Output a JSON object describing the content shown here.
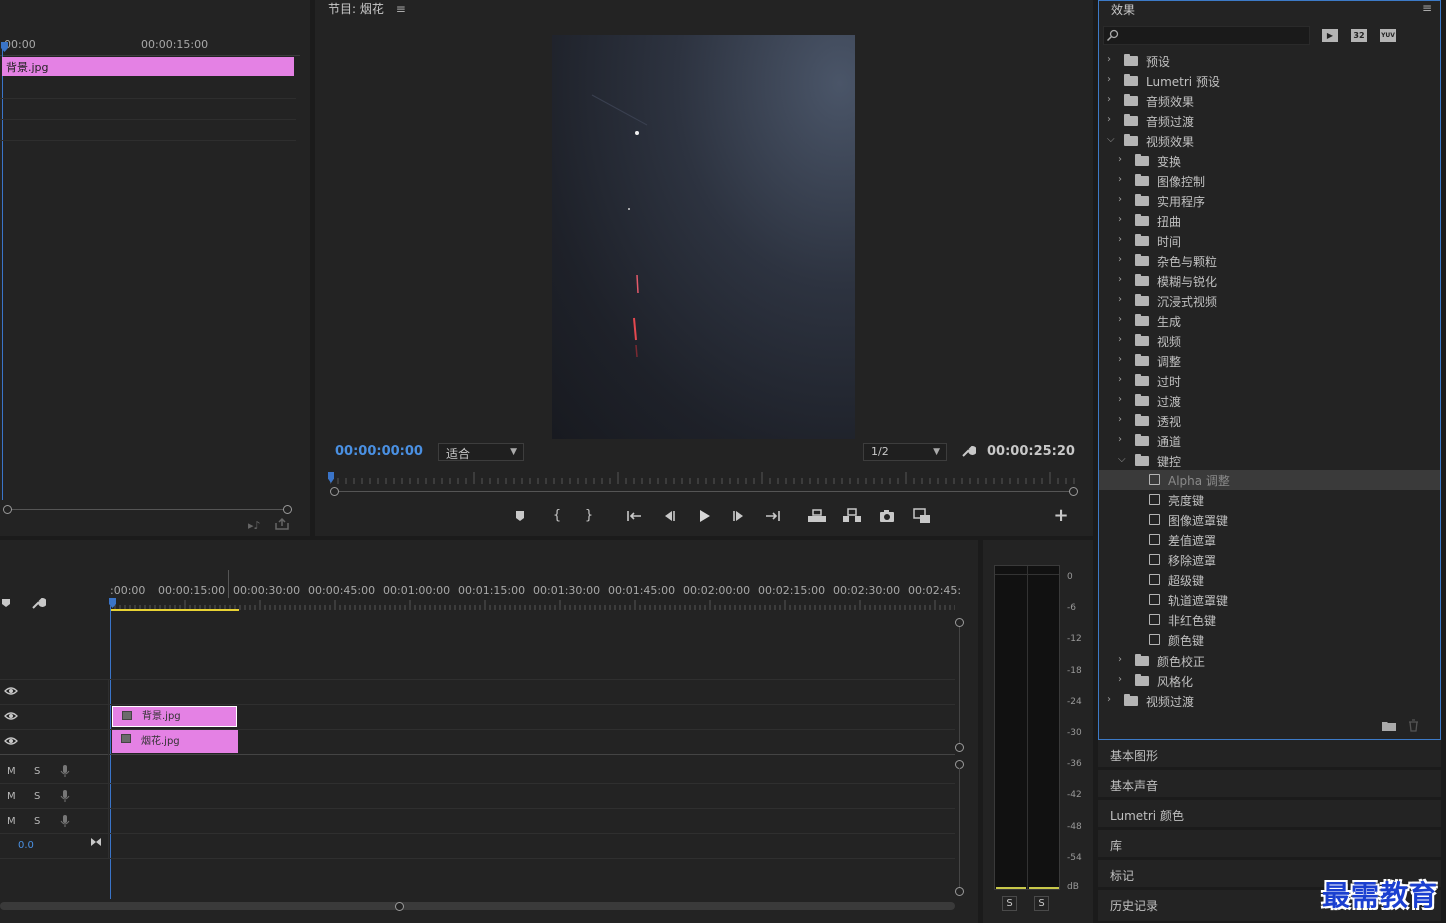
{
  "source": {
    "ruler_labels": [
      "00:00",
      "00:00:15:00"
    ],
    "clip_name": "背景.jpg"
  },
  "program": {
    "title": "节目: 烟花",
    "timecode_current": "00:00:00:00",
    "fit_select": "适合",
    "resolution_select": "1/2",
    "timecode_duration": "00:00:25:20"
  },
  "timeline": {
    "ruler_labels": [
      ":00:00",
      "00:00:15:00",
      "00:00:30:00",
      "00:00:45:00",
      "00:01:00:00",
      "00:01:15:00",
      "00:01:30:00",
      "00:01:45:00",
      "00:02:00:00",
      "00:02:15:00",
      "00:02:30:00",
      "00:02:45:"
    ],
    "clips": [
      {
        "name": "背景.jpg"
      },
      {
        "name": "烟花.jpg"
      }
    ],
    "audio_tracks": [
      {
        "m": "M",
        "s": "S"
      },
      {
        "m": "M",
        "s": "S"
      },
      {
        "m": "M",
        "s": "S"
      }
    ],
    "master_volume": "0.0"
  },
  "meter": {
    "scale": [
      "0",
      "-6",
      "-12",
      "-18",
      "-24",
      "-30",
      "-36",
      "-42",
      "-48",
      "-54",
      "dB"
    ],
    "solo_left": "S",
    "solo_right": "S"
  },
  "effects": {
    "title": "效果",
    "search_placeholder": "",
    "toolbar_icons": [
      "accelerated-effects-icon",
      "32bit-icon",
      "yuv-icon"
    ],
    "tree": [
      {
        "label": "预设",
        "level": 0,
        "kind": "special-folder",
        "state": "collapsed"
      },
      {
        "label": "Lumetri 预设",
        "level": 0,
        "kind": "special-folder",
        "state": "collapsed"
      },
      {
        "label": "音频效果",
        "level": 0,
        "kind": "folder",
        "state": "collapsed"
      },
      {
        "label": "音频过渡",
        "level": 0,
        "kind": "folder",
        "state": "collapsed"
      },
      {
        "label": "视频效果",
        "level": 0,
        "kind": "folder",
        "state": "expanded"
      },
      {
        "label": "变换",
        "level": 1,
        "kind": "folder",
        "state": "collapsed"
      },
      {
        "label": "图像控制",
        "level": 1,
        "kind": "folder",
        "state": "collapsed"
      },
      {
        "label": "实用程序",
        "level": 1,
        "kind": "folder",
        "state": "collapsed"
      },
      {
        "label": "扭曲",
        "level": 1,
        "kind": "folder",
        "state": "collapsed"
      },
      {
        "label": "时间",
        "level": 1,
        "kind": "folder",
        "state": "collapsed"
      },
      {
        "label": "杂色与颗粒",
        "level": 1,
        "kind": "folder",
        "state": "collapsed"
      },
      {
        "label": "模糊与锐化",
        "level": 1,
        "kind": "folder",
        "state": "collapsed"
      },
      {
        "label": "沉浸式视频",
        "level": 1,
        "kind": "folder",
        "state": "collapsed"
      },
      {
        "label": "生成",
        "level": 1,
        "kind": "folder",
        "state": "collapsed"
      },
      {
        "label": "视频",
        "level": 1,
        "kind": "folder",
        "state": "collapsed"
      },
      {
        "label": "调整",
        "level": 1,
        "kind": "folder",
        "state": "collapsed"
      },
      {
        "label": "过时",
        "level": 1,
        "kind": "folder",
        "state": "collapsed"
      },
      {
        "label": "过渡",
        "level": 1,
        "kind": "folder",
        "state": "collapsed"
      },
      {
        "label": "透视",
        "level": 1,
        "kind": "folder",
        "state": "collapsed"
      },
      {
        "label": "通道",
        "level": 1,
        "kind": "folder",
        "state": "collapsed"
      },
      {
        "label": "键控",
        "level": 1,
        "kind": "folder",
        "state": "expanded"
      },
      {
        "label": "Alpha 调整",
        "level": 2,
        "kind": "effect",
        "selected": true
      },
      {
        "label": "亮度键",
        "level": 2,
        "kind": "effect"
      },
      {
        "label": "图像遮罩键",
        "level": 2,
        "kind": "effect"
      },
      {
        "label": "差值遮罩",
        "level": 2,
        "kind": "effect"
      },
      {
        "label": "移除遮罩",
        "level": 2,
        "kind": "effect"
      },
      {
        "label": "超级键",
        "level": 2,
        "kind": "effect"
      },
      {
        "label": "轨道遮罩键",
        "level": 2,
        "kind": "effect"
      },
      {
        "label": "非红色键",
        "level": 2,
        "kind": "effect"
      },
      {
        "label": "颜色键",
        "level": 2,
        "kind": "effect"
      },
      {
        "label": "颜色校正",
        "level": 1,
        "kind": "folder",
        "state": "collapsed"
      },
      {
        "label": "风格化",
        "level": 1,
        "kind": "folder",
        "state": "collapsed"
      },
      {
        "label": "视频过渡",
        "level": 0,
        "kind": "folder",
        "state": "collapsed"
      }
    ]
  },
  "collapsed_panels": [
    "基本图形",
    "基本声音",
    "Lumetri 颜色",
    "库",
    "标记",
    "历史记录"
  ],
  "watermark": "最需教育",
  "colors": {
    "clip": "#e481e4",
    "accent_blue": "#4a90e2",
    "panel_border": "#3c7ac7",
    "work_area": "#e8d233"
  }
}
